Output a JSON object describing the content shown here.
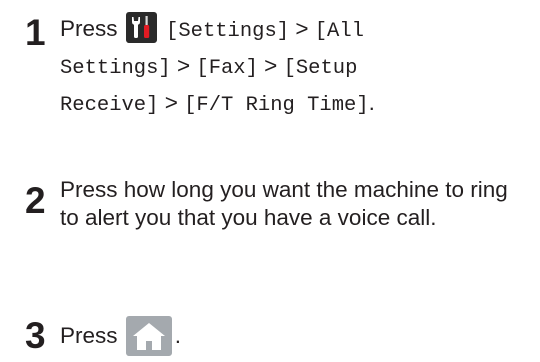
{
  "steps": [
    {
      "number": "1",
      "prefix": "Press",
      "icon": "settings-tools-icon",
      "path": [
        "[Settings]",
        "[All Settings]",
        "[Fax]",
        "[Setup Receive]",
        "[F/T Ring Time]"
      ],
      "separator": ">",
      "end": "."
    },
    {
      "number": "2",
      "text": "Press how long you want the machine to ring to alert you that you have a voice call."
    },
    {
      "number": "3",
      "prefix": "Press",
      "icon": "home-icon",
      "end": "."
    }
  ],
  "colors": {
    "text": "#231f20",
    "settings_icon_bg": "#2a2a2a",
    "settings_icon_accent": "#e31b23",
    "home_icon_bg": "#a4a9ae",
    "home_icon_fg": "#ffffff"
  }
}
